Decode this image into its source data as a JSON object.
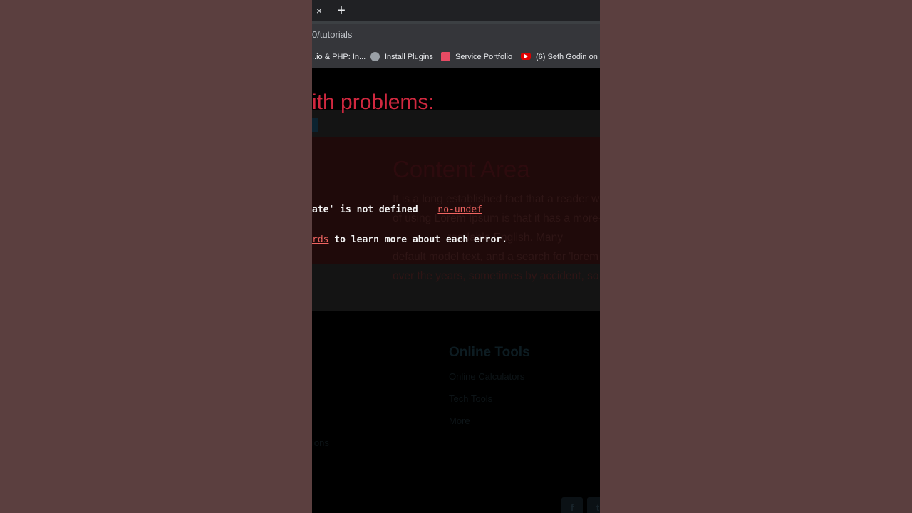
{
  "browser": {
    "tab_close": "×",
    "new_tab": "+",
    "url": "0/tutorials",
    "bookmarks": [
      {
        "label": "..io & PHP: In...",
        "icon": "none"
      },
      {
        "label": "Install Plugins",
        "icon": "globe-icon"
      },
      {
        "label": "Service Portfolio",
        "icon": "portfolio-icon"
      },
      {
        "label": "(6) Seth Godin on S",
        "icon": "youtube-icon"
      }
    ]
  },
  "overlay": {
    "problems_heading": "ith problems:",
    "error_text": "ate' is not defined",
    "error_rule": "no-undef",
    "hint_link": "rds",
    "hint_text": " to learn more about each error."
  },
  "site": {
    "content_title": "Content Area",
    "content_lines": [
      "It is a long established fact that a reader w",
      "of using Lorem Ipsum is that it has a more-",
      "readable English. Many",
      "default model text, and a search for 'lorem",
      "over the years, sometimes by accident, so"
    ],
    "footer": {
      "title": "Online Tools",
      "links": [
        "Online Calculators",
        "Tech Tools",
        "More"
      ],
      "left_text": "ions"
    },
    "social": [
      "f",
      "t"
    ]
  },
  "colors": {
    "page_background": "#5b3f3f",
    "error_red": "#d0283f",
    "link_red": "#ef6461"
  }
}
